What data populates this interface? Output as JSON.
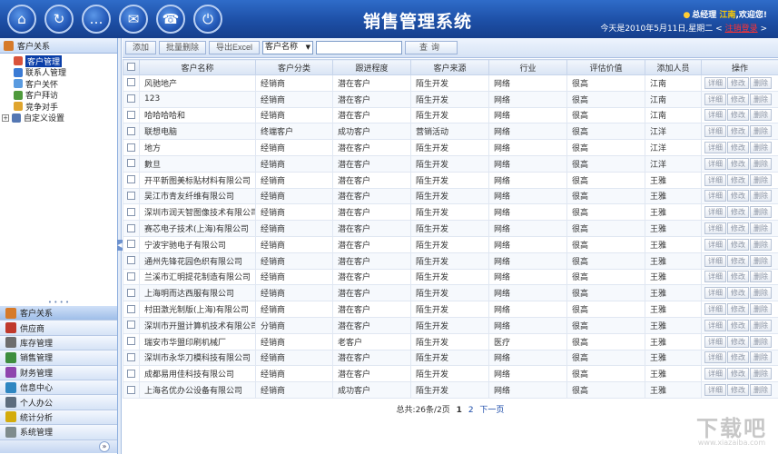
{
  "app": {
    "title": "销售管理系统"
  },
  "header": {
    "icons": [
      "home-icon",
      "refresh-icon",
      "chat-icon",
      "mail-icon",
      "phone-icon",
      "power-icon"
    ],
    "greeting_prefix": "总经理",
    "user_name": "江南",
    "greeting_suffix": ",欢迎您!",
    "date_text": "今天是2010年5月11日,星期二 <",
    "logout_label": "注销登录",
    "date_close": ">"
  },
  "sidebar": {
    "section_title": "客户关系",
    "tree": [
      {
        "label": "客户管理",
        "selected": true,
        "icon": "user-icon",
        "color": "#d9533b"
      },
      {
        "label": "联系人管理",
        "selected": false,
        "icon": "contacts-icon",
        "color": "#3a7bd5"
      },
      {
        "label": "客户关怀",
        "selected": false,
        "icon": "care-icon",
        "color": "#5a9be0"
      },
      {
        "label": "客户拜访",
        "selected": false,
        "icon": "visit-icon",
        "color": "#4f9a3c"
      },
      {
        "label": "竞争对手",
        "selected": false,
        "icon": "competitor-icon",
        "color": "#e0a52e"
      }
    ],
    "custom_settings": "自定义设置",
    "accordion": [
      {
        "label": "客户关系",
        "active": true,
        "icon": "customer-icon",
        "color": "#d67a2a"
      },
      {
        "label": "供应商",
        "active": false,
        "icon": "supplier-icon",
        "color": "#c0392b"
      },
      {
        "label": "库存管理",
        "active": false,
        "icon": "inventory-icon",
        "color": "#6d6d6d"
      },
      {
        "label": "销售管理",
        "active": false,
        "icon": "sales-icon",
        "color": "#3e8e3e"
      },
      {
        "label": "财务管理",
        "active": false,
        "icon": "finance-icon",
        "color": "#8e44ad"
      },
      {
        "label": "信息中心",
        "active": false,
        "icon": "info-icon",
        "color": "#2e86c1"
      },
      {
        "label": "个人办公",
        "active": false,
        "icon": "office-icon",
        "color": "#5d6d7e"
      },
      {
        "label": "统计分析",
        "active": false,
        "icon": "stats-icon",
        "color": "#d4ac0d"
      },
      {
        "label": "系统管理",
        "active": false,
        "icon": "system-icon",
        "color": "#7f8c8d"
      }
    ]
  },
  "toolbar": {
    "add_label": "添加",
    "batch_delete_label": "批量删除",
    "export_label": "导出Excel",
    "field_select": "客户名称",
    "search_value": "",
    "query_label": "查询"
  },
  "table": {
    "columns": [
      "客户名称",
      "客户分类",
      "跟进程度",
      "客户来源",
      "行业",
      "评估价值",
      "添加人员",
      "操作"
    ],
    "actions": [
      "详细",
      "修改",
      "删除"
    ],
    "rows": [
      [
        "风驰地产",
        "经销商",
        "潜在客户",
        "陌生开发",
        "网络",
        "很高",
        "江南"
      ],
      [
        "123",
        "经销商",
        "潜在客户",
        "陌生开发",
        "网络",
        "很高",
        "江南"
      ],
      [
        "哈哈哈哈和",
        "经销商",
        "潜在客户",
        "陌生开发",
        "网络",
        "很高",
        "江南"
      ],
      [
        "联想电脑",
        "终端客户",
        "成功客户",
        "营销活动",
        "网络",
        "很高",
        "江洋"
      ],
      [
        "地方",
        "经销商",
        "潜在客户",
        "陌生开发",
        "网络",
        "很高",
        "江洋"
      ],
      [
        "數旦",
        "经销商",
        "潜在客户",
        "陌生开发",
        "网络",
        "很高",
        "江洋"
      ],
      [
        "开平新图美标贴材料有限公司",
        "经销商",
        "潜在客户",
        "陌生开发",
        "网络",
        "很高",
        "王雅"
      ],
      [
        "吴江市青友纤维有限公司",
        "经销商",
        "潜在客户",
        "陌生开发",
        "网络",
        "很高",
        "王雅"
      ],
      [
        "深圳市润天智图像技术有限公司",
        "经销商",
        "潜在客户",
        "陌生开发",
        "网络",
        "很高",
        "王雅"
      ],
      [
        "赛芯电子技术(上海)有限公司",
        "经销商",
        "潜在客户",
        "陌生开发",
        "网络",
        "很高",
        "王雅"
      ],
      [
        "宁波宇驰电子有限公司",
        "经销商",
        "潜在客户",
        "陌生开发",
        "网络",
        "很高",
        "王雅"
      ],
      [
        "通州先锋花园色织有限公司",
        "经销商",
        "潜在客户",
        "陌生开发",
        "网络",
        "很高",
        "王雅"
      ],
      [
        "兰溪市汇明提花制造有限公司",
        "经销商",
        "潜在客户",
        "陌生开发",
        "网络",
        "很高",
        "王雅"
      ],
      [
        "上海明而达西服有限公司",
        "经销商",
        "潜在客户",
        "陌生开发",
        "网络",
        "很高",
        "王雅"
      ],
      [
        "村田激光制版(上海)有限公司",
        "经销商",
        "潜在客户",
        "陌生开发",
        "网络",
        "很高",
        "王雅"
      ],
      [
        "深圳市开盟计算机技术有限公司",
        "分销商",
        "潜在客户",
        "陌生开发",
        "网络",
        "很高",
        "王雅"
      ],
      [
        "瑞安市华盟印刷机械厂",
        "经销商",
        "老客户",
        "陌生开发",
        "医疗",
        "很高",
        "王雅"
      ],
      [
        "深圳市永华刀模科技有限公司",
        "经销商",
        "潜在客户",
        "陌生开发",
        "网络",
        "很高",
        "王雅"
      ],
      [
        "成都易用佳科技有限公司",
        "经销商",
        "潜在客户",
        "陌生开发",
        "网络",
        "很高",
        "王雅"
      ],
      [
        "上海名优办公设备有限公司",
        "经销商",
        "成功客户",
        "陌生开发",
        "网络",
        "很高",
        "王雅"
      ]
    ]
  },
  "pager": {
    "summary": "总共:26条/2页",
    "pages": [
      "1",
      "2"
    ],
    "next_label": "下一页"
  },
  "watermark": {
    "text": "下载吧",
    "sub": "www.xiazaiba.com"
  }
}
